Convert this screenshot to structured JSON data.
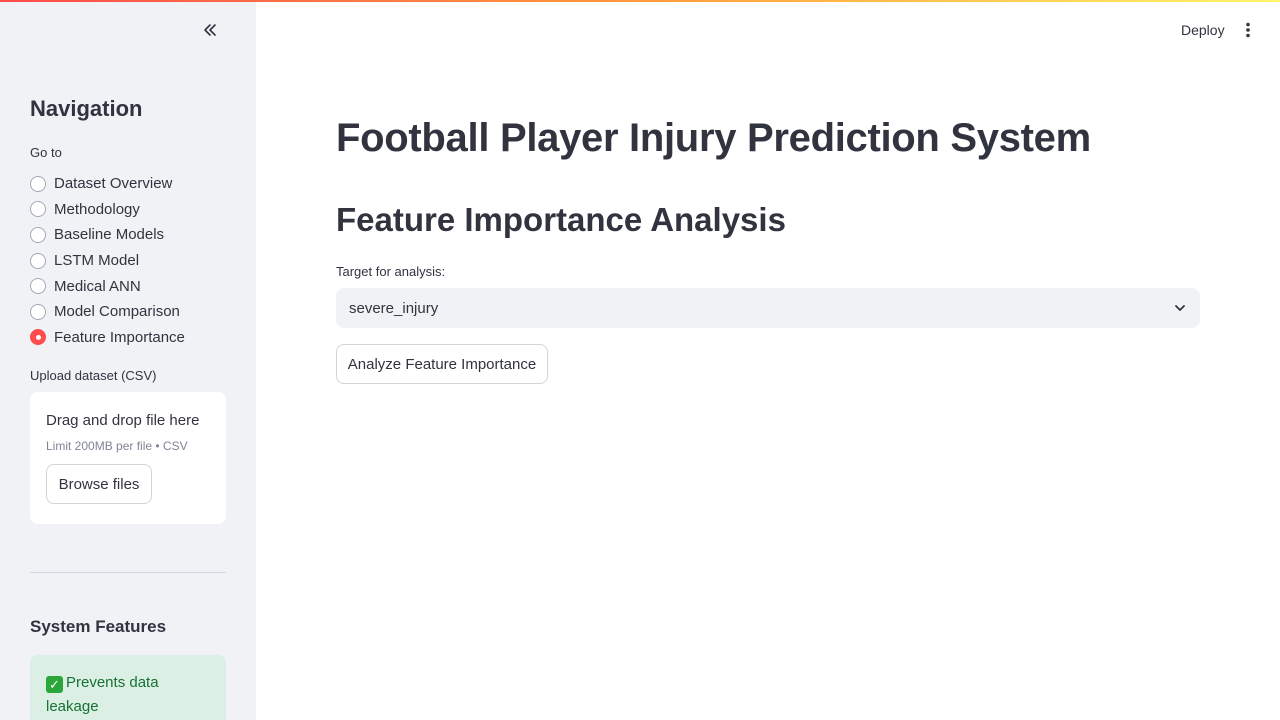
{
  "header": {
    "deploy_label": "Deploy",
    "menu_icon": "kebab-menu-icon"
  },
  "sidebar": {
    "collapse_icon": "double-chevron-left-icon",
    "nav_title": "Navigation",
    "goto_label": "Go to",
    "options": [
      {
        "label": "Dataset Overview",
        "selected": false
      },
      {
        "label": "Methodology",
        "selected": false
      },
      {
        "label": "Baseline Models",
        "selected": false
      },
      {
        "label": "LSTM Model",
        "selected": false
      },
      {
        "label": "Medical ANN",
        "selected": false
      },
      {
        "label": "Model Comparison",
        "selected": false
      },
      {
        "label": "Feature Importance",
        "selected": true
      }
    ],
    "upload": {
      "label": "Upload dataset (CSV)",
      "drop_text": "Drag and drop file here",
      "limit_text": "Limit 200MB per file • CSV",
      "browse_label": "Browse files"
    },
    "features_title": "System Features",
    "features": [
      {
        "icon": "check-mark-icon",
        "text": "Prevents data leakage"
      }
    ]
  },
  "main": {
    "title": "Football Player Injury Prediction System",
    "subtitle": "Feature Importance Analysis",
    "target_label": "Target for analysis:",
    "target_value": "severe_injury",
    "analyze_label": "Analyze Feature Importance"
  },
  "colors": {
    "accent": "#ff4b4b",
    "sidebar_bg": "#f0f2f6",
    "text": "#31333f",
    "success_bg": "#dbefe5",
    "success_text": "#177233"
  }
}
